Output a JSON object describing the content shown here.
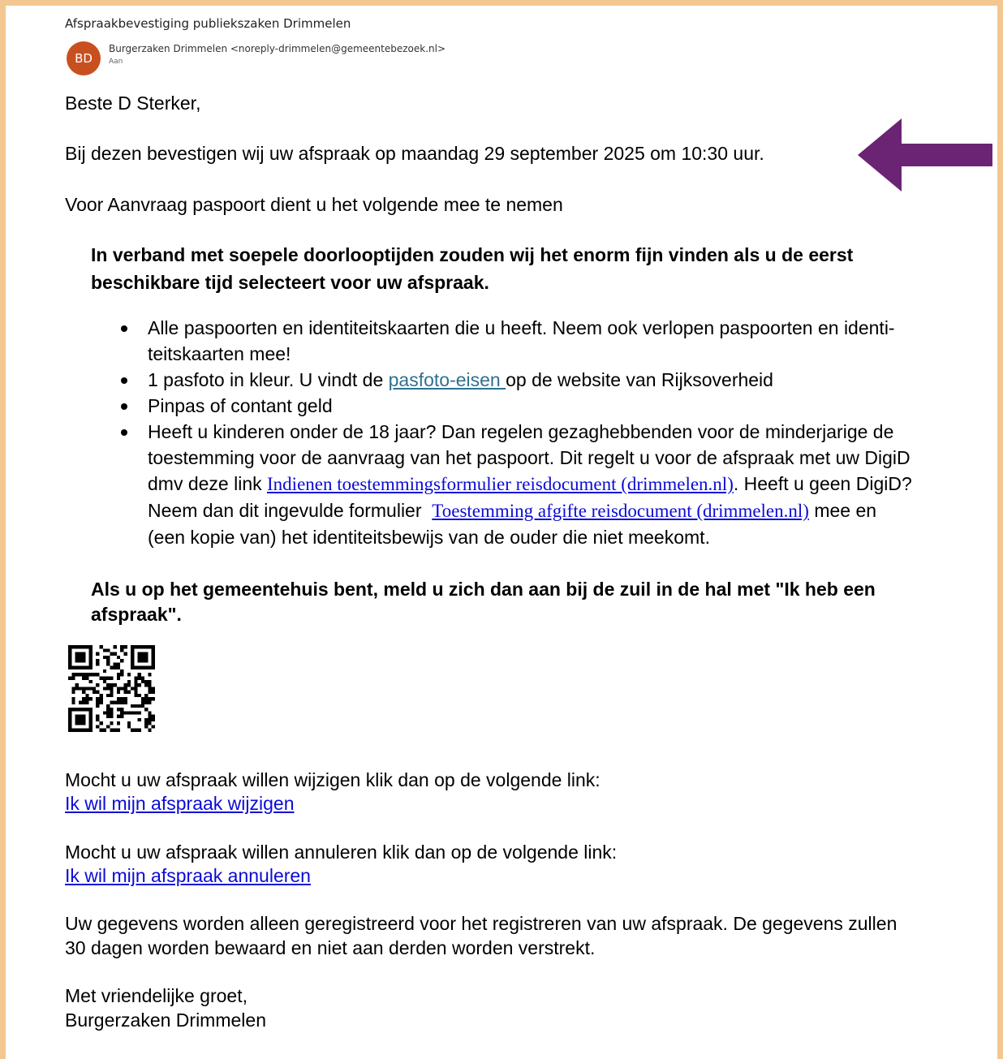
{
  "email": {
    "subject": "Afspraakbevestiging publiekszaken Drimmelen",
    "avatar_initials": "BD",
    "avatar_color": "#c8501f",
    "sender": "Burgerzaken Drimmelen <noreply-drimmelen@gemeentebezoek.nl>",
    "to_label": "Aan"
  },
  "body": {
    "greeting": "Beste D Sterker,",
    "confirmation": "Bij dezen bevestigen wij uw afspraak op maandag 29 september 2025 om 10:30 uur.",
    "intro": "Voor Aanvraag paspoort dient u het volgende mee te nemen",
    "notice_line1": "In verband met soepele doorlooptijden zouden wij het enorm fijn vinden als u de eerst",
    "notice_line2": "beschikbare tijd selecteert voor uw afspraak.",
    "bullets": {
      "b1_line1": "Alle paspoorten en identiteitskaarten die u heeft. Neem ook verlopen paspoorten en identi-",
      "b1_line2": "teitskaarten mee!",
      "b2_before": "1 pasfoto in kleur. U vindt de ",
      "b2_link": "pasfoto-eisen ",
      "b2_after": "op de website van Rijksoverheid",
      "b3": "Pinpas of contant geld",
      "b4_line1": "Heeft u kinderen onder de 18 jaar? Dan regelen gezaghebbenden voor de minderjarige de",
      "b4_line2": "toestemming voor de aanvraag van het paspoort. Dit regelt u voor de afspraak met uw DigiD",
      "b4_line3_before": "dmv deze link ",
      "b4_link1": "Indienen toestemmingsformulier reisdocument (drimmelen.nl)",
      "b4_line3_after": ". Heeft u geen DigiD?",
      "b4_line4_before": "Neem dan dit ingevulde formulier  ",
      "b4_link2": "Toestemming afgifte reisdocument (drimmelen.nl)",
      "b4_line4_after": " mee en",
      "b4_line5": "(een kopie van) het identiteitsbewijs van de ouder die niet meekomt."
    },
    "checkin_line1": "Als u op het gemeentehuis bent, meld u zich dan aan bij de zuil in de hal met \"Ik heb een",
    "checkin_line2": "afspraak\".",
    "change_text": "Mocht u uw afspraak willen wijzigen klik dan op de volgende link:",
    "change_link": "Ik wil mijn afspraak wijzigen",
    "cancel_text": "Mocht u uw afspraak willen annuleren klik dan op de volgende link:",
    "cancel_link": "Ik wil mijn afspraak annuleren",
    "privacy_line1": "Uw gegevens worden alleen geregistreerd voor het registreren van uw afspraak. De gegevens zullen",
    "privacy_line2": "30 dagen worden bewaard en niet aan derden worden verstrekt.",
    "closing": "Met vriendelijke groet,",
    "signature": "Burgerzaken Drimmelen"
  },
  "annotation": {
    "arrow_color": "#6b2473"
  }
}
